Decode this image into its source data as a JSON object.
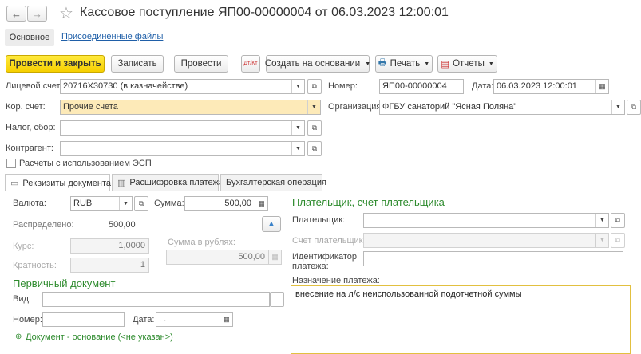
{
  "title": "Кассовое поступление ЯП00-00000004 от 06.03.2023 12:00:01",
  "top_tabs": {
    "main": "Основное",
    "files": "Присоединенные файлы"
  },
  "toolbar": {
    "post_close": "Провести и закрыть",
    "save": "Записать",
    "post": "Провести",
    "dtkt": "Дт/Кт",
    "create_based": "Создать на основании",
    "print": "Печать",
    "reports": "Отчеты"
  },
  "form": {
    "account_label": "Лицевой счет:",
    "account_value": "20716Х30730 (в казначействе)",
    "number_label": "Номер:",
    "number_value": "ЯП00-00000004",
    "date_label": "Дата:",
    "date_value": "06.03.2023 12:00:01",
    "corr_label": "Кор. счет:",
    "corr_value": "Прочие счета",
    "org_label": "Организация:",
    "org_value": "ФГБУ санаторий \"Ясная Поляна\"",
    "tax_label": "Налог, сбор:",
    "tax_value": "",
    "contractor_label": "Контрагент:",
    "contractor_value": "",
    "esp_label": "Расчеты с использованием ЭСП"
  },
  "tabs": [
    "Реквизиты документа",
    "Расшифровка платежа",
    "Бухгалтерская операция"
  ],
  "details": {
    "currency_label": "Валюта:",
    "currency_value": "RUB",
    "sum_label": "Сумма:",
    "sum_value": "500,00",
    "distributed_label": "Распределено:",
    "distributed_value": "500,00",
    "rate_label": "Курс:",
    "rate_value": "1,0000",
    "rub_sum_label": "Сумма в рублях:",
    "rub_sum_value": "500,00",
    "multiplicity_label": "Кратность:",
    "multiplicity_value": "1",
    "primary_doc_header": "Первичный документ",
    "kind_label": "Вид:",
    "kind_value": "",
    "doc_number_label": "Номер:",
    "doc_number_value": "",
    "doc_date_label": "Дата:",
    "doc_date_value": " .  .",
    "basis_doc": "Документ - основание (<не указан>)"
  },
  "payer": {
    "header": "Плательщик, счет плательщика",
    "payer_label": "Плательщик:",
    "payer_value": "",
    "payer_account_label": "Счет плательщика:",
    "payer_account_value": "",
    "id_label": "Идентификатор платежа:",
    "id_value": "",
    "purpose_label": "Назначение платежа:",
    "purpose_value": "внесение на л/с неиспользованной подотчетной суммы"
  }
}
